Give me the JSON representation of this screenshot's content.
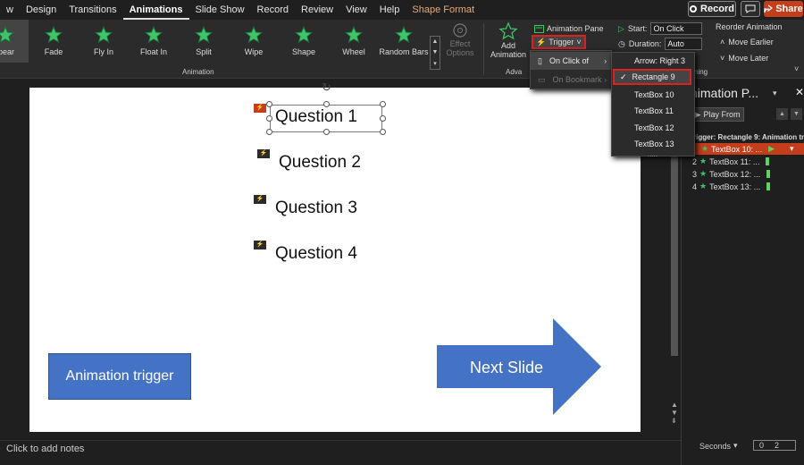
{
  "tabs": [
    "w",
    "Design",
    "Transitions",
    "Animations",
    "Slide Show",
    "Record",
    "Review",
    "View",
    "Help",
    "Shape Format"
  ],
  "active_tab": "Animations",
  "record_label": "Record",
  "share_label": "Share",
  "gallery": [
    {
      "label": "pear",
      "icon": "appear-star-icon"
    },
    {
      "label": "Fade",
      "icon": "fade-star-icon"
    },
    {
      "label": "Fly In",
      "icon": "fly-in-star-icon"
    },
    {
      "label": "Float In",
      "icon": "float-in-star-icon"
    },
    {
      "label": "Split",
      "icon": "split-star-icon"
    },
    {
      "label": "Wipe",
      "icon": "wipe-star-icon"
    },
    {
      "label": "Shape",
      "icon": "shape-star-icon"
    },
    {
      "label": "Wheel",
      "icon": "wheel-star-icon"
    },
    {
      "label": "Random Bars",
      "icon": "random-bars-star-icon"
    }
  ],
  "effect_options": {
    "line1": "Effect",
    "line2": "Options"
  },
  "group_animation": "Animation",
  "add_animation": {
    "line1": "Add",
    "line2": "Animation"
  },
  "group_advanced": "Adva",
  "animation_pane_btn": "Animation Pane",
  "trigger_btn": "Trigger",
  "timing": {
    "start_label": "Start:",
    "start_value": "On Click",
    "duration_label": "Duration:",
    "duration_value": "Auto",
    "delay_label": "Arrow: Right 3"
  },
  "group_timing": "ning",
  "reorder": {
    "title": "Reorder Animation",
    "earlier": "Move Earlier",
    "later": "Move Later"
  },
  "trigger_menu": {
    "on_click": "On Click of",
    "on_bookmark": "On Bookmark"
  },
  "shape_menu": {
    "items": [
      "Rectangle 9",
      "TextBox 10",
      "TextBox 11",
      "TextBox 12",
      "TextBox 13"
    ],
    "checked": "Rectangle 9",
    "more": "....."
  },
  "slide": {
    "questions": [
      "Question 1",
      "Question 2",
      "Question 3",
      "Question 4"
    ],
    "trigger_shape": "Animation trigger",
    "next_arrow": "Next Slide",
    "tag_glyph": "⚡",
    "rotate_glyph": "↻"
  },
  "notes_placeholder": "Click to add notes",
  "pane": {
    "title": "nimation P...",
    "play_from": "Play From",
    "trigger_heading": "rigger: Rectangle 9: Animation tri...",
    "rows": [
      {
        "num": "",
        "label": "TextBox 10: ..."
      },
      {
        "num": "2",
        "label": "TextBox 11: ..."
      },
      {
        "num": "3",
        "label": "TextBox 12: ..."
      },
      {
        "num": "4",
        "label": "TextBox 13: ..."
      }
    ],
    "seconds": "Seconds",
    "zoom": {
      "left": "0",
      "mid": "2",
      "right": ""
    }
  },
  "colors": {
    "accent": "#c43e1c",
    "shape_blue": "#4472c4",
    "star_green": "#3ec46a",
    "highlight_red": "#e02020"
  }
}
